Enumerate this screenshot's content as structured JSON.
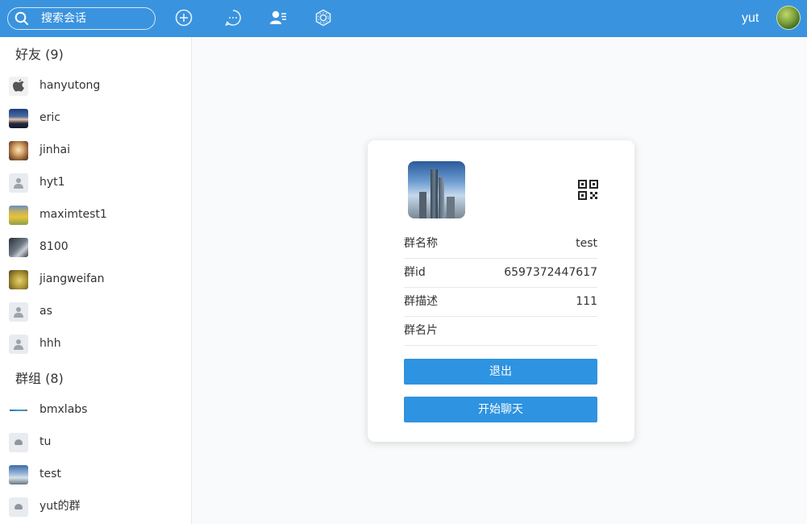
{
  "topbar": {
    "search_placeholder": "搜索会话",
    "icons": [
      "search-icon",
      "add-icon",
      "chat-icon",
      "contacts-icon",
      "settings-icon"
    ],
    "username": "yut"
  },
  "sidebar": {
    "friends_title": "好友 (9)",
    "friends": [
      {
        "name": "hanyutong",
        "avatar": "apple"
      },
      {
        "name": "eric",
        "avatar": "photo"
      },
      {
        "name": "jinhai",
        "avatar": "photo"
      },
      {
        "name": "hyt1",
        "avatar": "default"
      },
      {
        "name": "maximtest1",
        "avatar": "photo"
      },
      {
        "name": "8100",
        "avatar": "photo"
      },
      {
        "name": "jiangweifan",
        "avatar": "photo"
      },
      {
        "name": "as",
        "avatar": "default"
      },
      {
        "name": "hhh",
        "avatar": "default"
      }
    ],
    "groups_title": "群组 (8)",
    "groups": [
      {
        "name": "bmxlabs",
        "avatar": "logo"
      },
      {
        "name": "tu",
        "avatar": "group-default"
      },
      {
        "name": "test",
        "avatar": "photo"
      },
      {
        "name": "yut的群",
        "avatar": "group-default"
      }
    ]
  },
  "card": {
    "fields": [
      {
        "label": "群名称",
        "value": "test"
      },
      {
        "label": "群id",
        "value": "6597372447617"
      },
      {
        "label": "群描述",
        "value": "111"
      },
      {
        "label": "群名片",
        "value": ""
      }
    ],
    "quit_button": "退出",
    "chat_button": "开始聊天"
  },
  "colors": {
    "topbar": "#3a93de",
    "button": "#2e93e0"
  }
}
